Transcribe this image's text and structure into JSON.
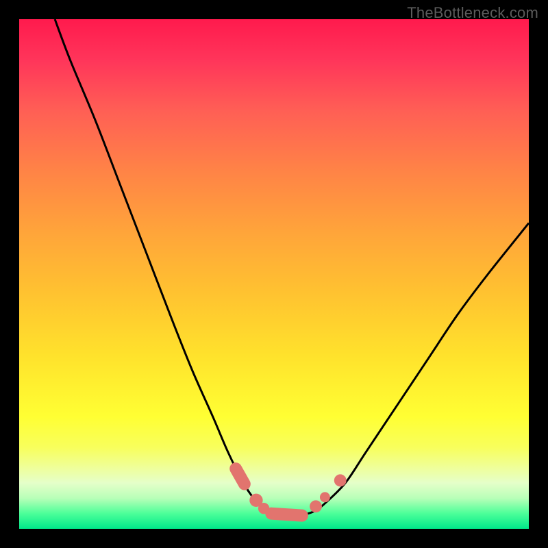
{
  "watermark": "TheBottleneck.com",
  "chart_data": {
    "type": "line",
    "title": "",
    "xlabel": "",
    "ylabel": "",
    "xlim": [
      0,
      100
    ],
    "ylim": [
      0,
      100
    ],
    "series": [
      {
        "name": "curve",
        "x": [
          7,
          10,
          15,
          20,
          25,
          30,
          34,
          38,
          41,
          44,
          46,
          48,
          50,
          52,
          54,
          56,
          58,
          60,
          64,
          68,
          74,
          80,
          86,
          92,
          100
        ],
        "y": [
          100,
          92,
          80,
          67,
          54,
          41,
          31,
          22,
          15,
          9,
          6,
          4,
          3,
          2.5,
          2.5,
          2.8,
          3.5,
          5,
          9,
          15,
          24,
          33,
          42,
          50,
          60
        ]
      }
    ],
    "markers": [
      {
        "shape": "capsule",
        "x1": 42.5,
        "y1": 11.8,
        "x2": 44.2,
        "y2": 8.8
      },
      {
        "shape": "circle",
        "cx": 46.5,
        "cy": 5.6,
        "r": 1.3
      },
      {
        "shape": "circle",
        "cx": 48.0,
        "cy": 4.0,
        "r": 1.1
      },
      {
        "shape": "capsule",
        "x1": 49.5,
        "y1": 3.0,
        "x2": 55.5,
        "y2": 2.6
      },
      {
        "shape": "circle",
        "cx": 58.2,
        "cy": 4.4,
        "r": 1.2
      },
      {
        "shape": "circle",
        "cx": 60.0,
        "cy": 6.2,
        "r": 1.0
      },
      {
        "shape": "circle",
        "cx": 63.0,
        "cy": 9.5,
        "r": 1.2
      }
    ],
    "colors": {
      "gradient_top": "#ff1a4d",
      "gradient_mid": "#ffe22c",
      "gradient_bottom": "#00e88a",
      "curve": "#000000",
      "markers": "#e2746e",
      "frame": "#000000"
    }
  }
}
